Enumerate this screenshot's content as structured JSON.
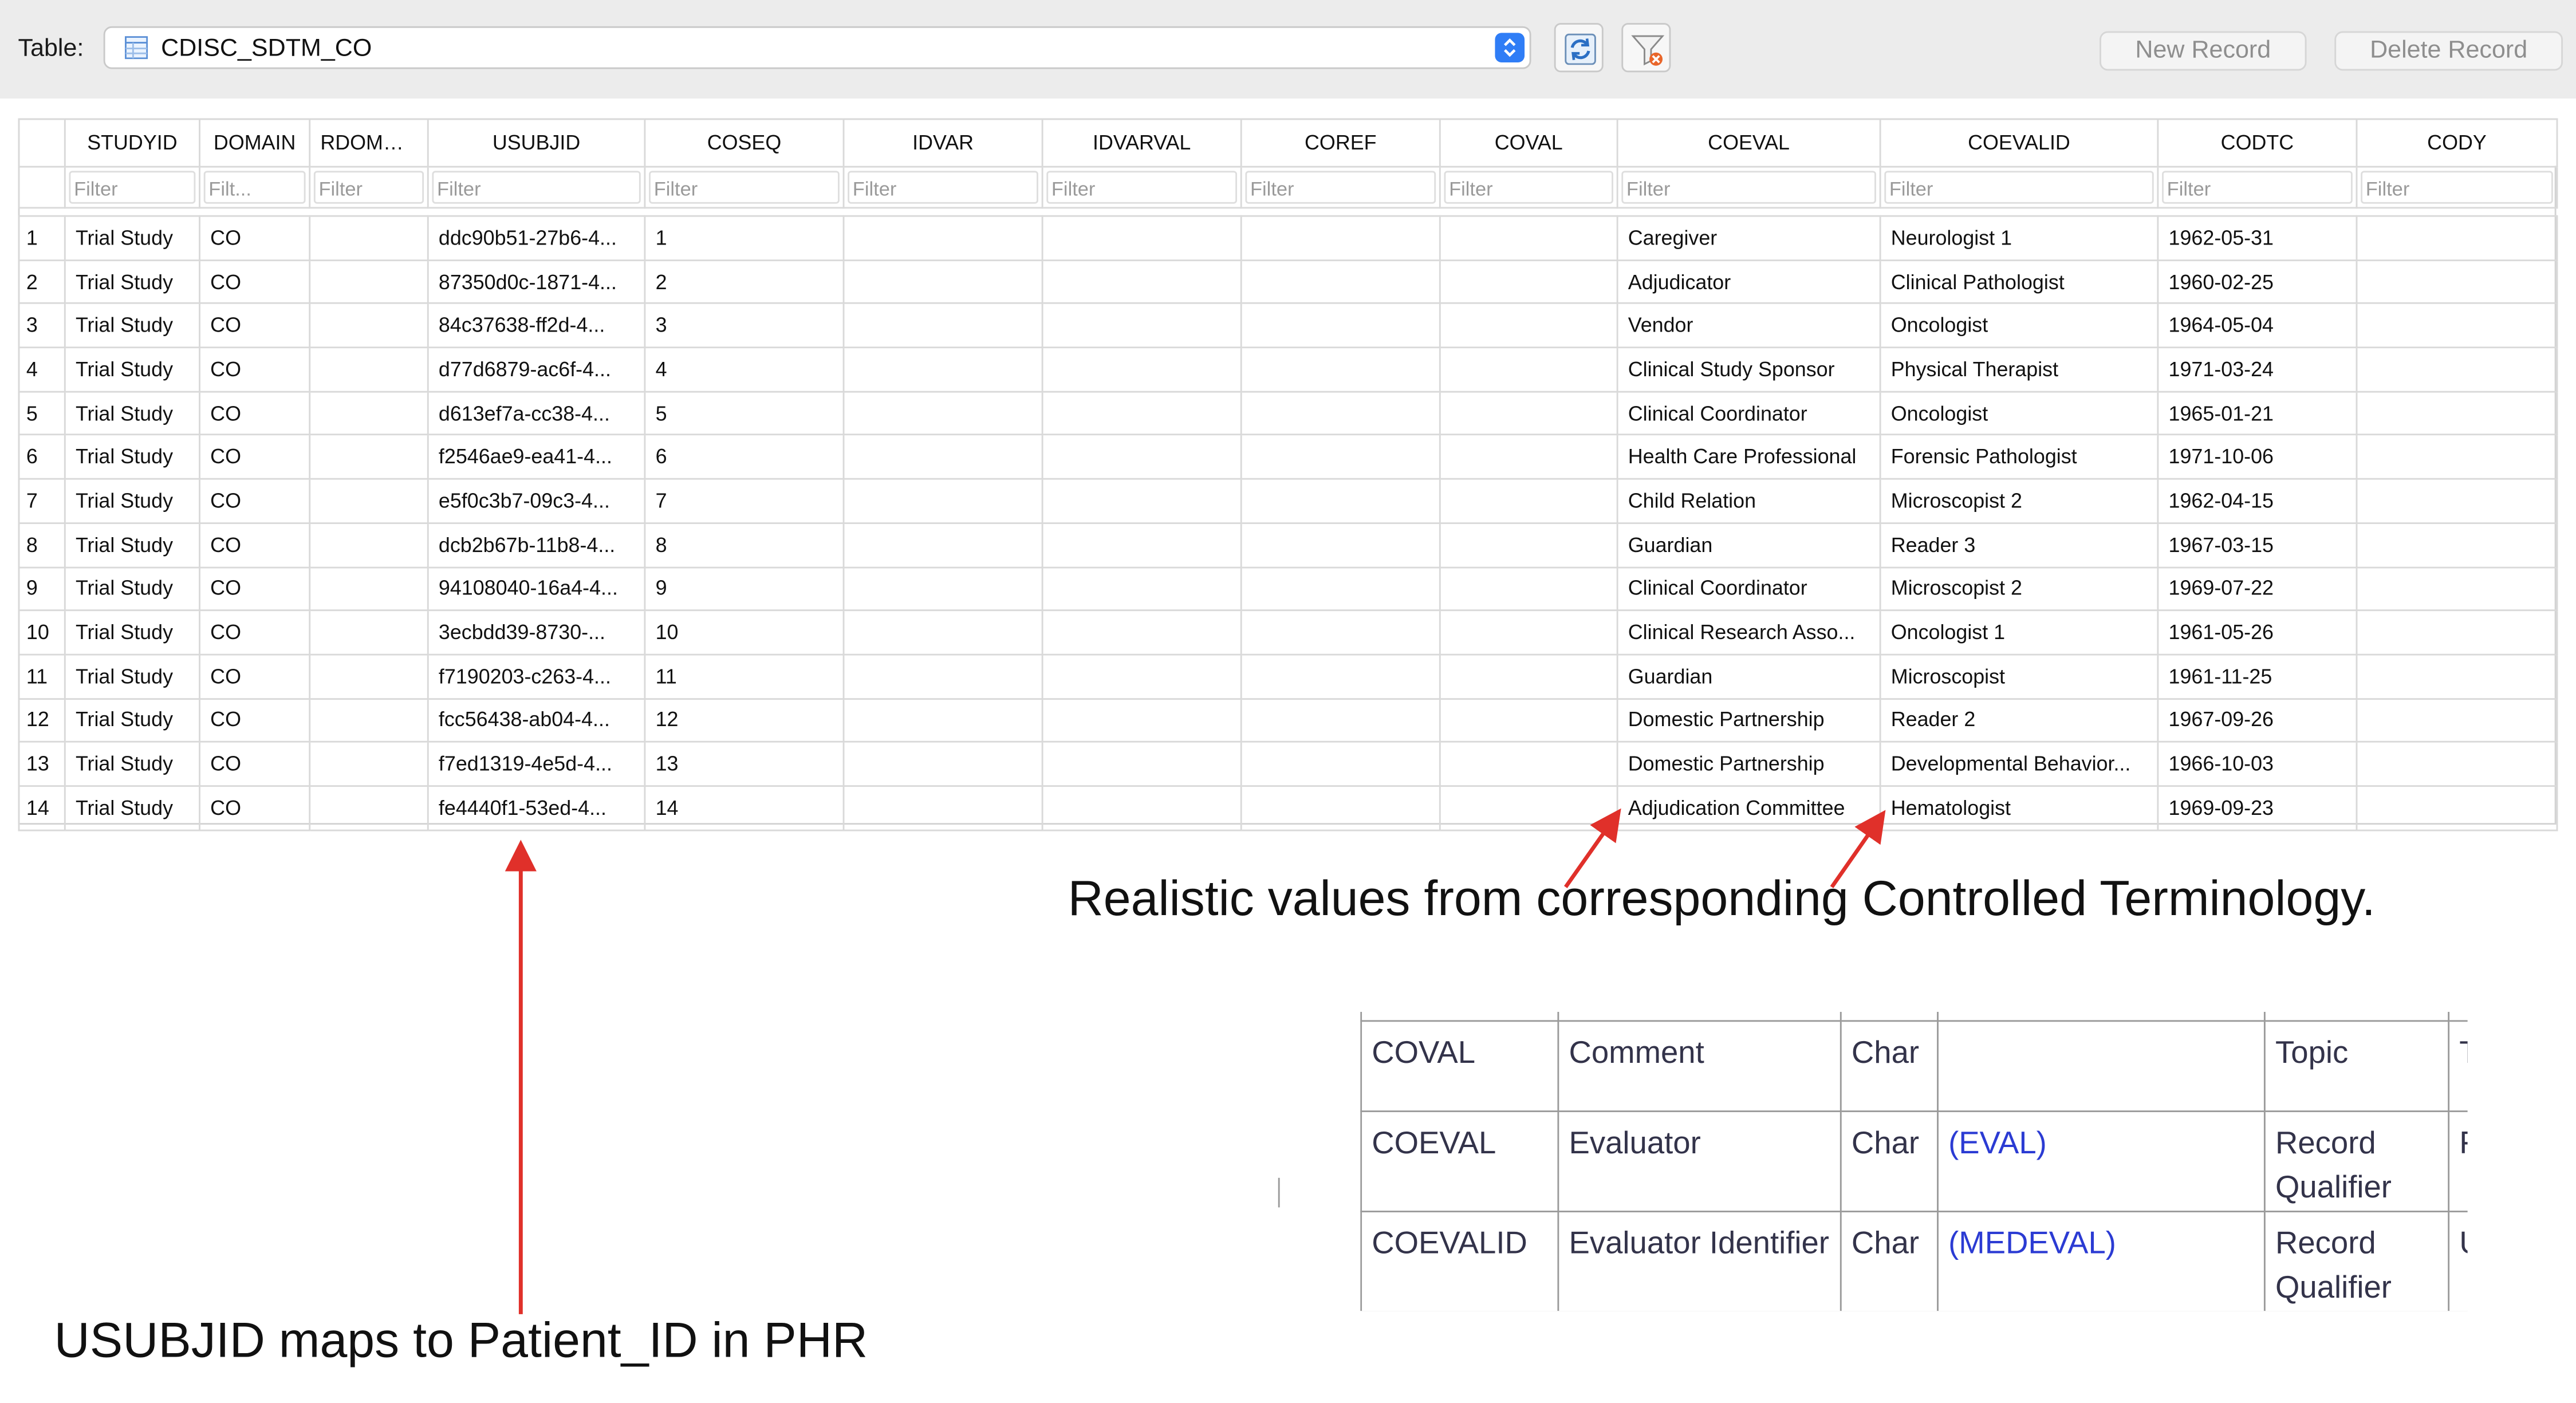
{
  "toolbar": {
    "table_label": "Table:",
    "table_name": "CDISC_SDTM_CO",
    "new_record": "New Record",
    "delete_record": "Delete Record",
    "icons": [
      "table-icon",
      "stepper-icon",
      "refresh-icon",
      "clear-filter-icon"
    ]
  },
  "grid": {
    "columns": [
      "STUDYID",
      "DOMAIN",
      "RDOMAIN",
      "USUBJID",
      "COSEQ",
      "IDVAR",
      "IDVARVAL",
      "COREF",
      "COVAL",
      "COEVAL",
      "COEVALID",
      "CODTC",
      "CODY"
    ],
    "filters": [
      "Filter",
      "Filt...",
      "Filter",
      "Filter",
      "Filter",
      "Filter",
      "Filter",
      "Filter",
      "Filter",
      "Filter",
      "Filter",
      "Filter",
      "Filter"
    ],
    "rows": [
      {
        "n": "1",
        "studyid": "Trial Study",
        "domain": "CO",
        "rdomain": "",
        "usubjid": "ddc90b51-27b6-4...",
        "coseq": "1",
        "idvar": "",
        "idvarval": "",
        "coref": "",
        "coval": "",
        "coeval": "Caregiver",
        "coevalid": "Neurologist 1",
        "codtc": "1962-05-31",
        "cody": ""
      },
      {
        "n": "2",
        "studyid": "Trial Study",
        "domain": "CO",
        "rdomain": "",
        "usubjid": "87350d0c-1871-4...",
        "coseq": "2",
        "idvar": "",
        "idvarval": "",
        "coref": "",
        "coval": "",
        "coeval": "Adjudicator",
        "coevalid": "Clinical Pathologist",
        "codtc": "1960-02-25",
        "cody": ""
      },
      {
        "n": "3",
        "studyid": "Trial Study",
        "domain": "CO",
        "rdomain": "",
        "usubjid": "84c37638-ff2d-4...",
        "coseq": "3",
        "idvar": "",
        "idvarval": "",
        "coref": "",
        "coval": "",
        "coeval": "Vendor",
        "coevalid": "Oncologist",
        "codtc": "1964-05-04",
        "cody": ""
      },
      {
        "n": "4",
        "studyid": "Trial Study",
        "domain": "CO",
        "rdomain": "",
        "usubjid": "d77d6879-ac6f-4...",
        "coseq": "4",
        "idvar": "",
        "idvarval": "",
        "coref": "",
        "coval": "",
        "coeval": "Clinical Study Sponsor",
        "coevalid": "Physical Therapist",
        "codtc": "1971-03-24",
        "cody": ""
      },
      {
        "n": "5",
        "studyid": "Trial Study",
        "domain": "CO",
        "rdomain": "",
        "usubjid": "d613ef7a-cc38-4...",
        "coseq": "5",
        "idvar": "",
        "idvarval": "",
        "coref": "",
        "coval": "",
        "coeval": "Clinical Coordinator",
        "coevalid": "Oncologist",
        "codtc": "1965-01-21",
        "cody": ""
      },
      {
        "n": "6",
        "studyid": "Trial Study",
        "domain": "CO",
        "rdomain": "",
        "usubjid": "f2546ae9-ea41-4...",
        "coseq": "6",
        "idvar": "",
        "idvarval": "",
        "coref": "",
        "coval": "",
        "coeval": "Health Care Professional",
        "coevalid": "Forensic Pathologist",
        "codtc": "1971-10-06",
        "cody": ""
      },
      {
        "n": "7",
        "studyid": "Trial Study",
        "domain": "CO",
        "rdomain": "",
        "usubjid": "e5f0c3b7-09c3-4...",
        "coseq": "7",
        "idvar": "",
        "idvarval": "",
        "coref": "",
        "coval": "",
        "coeval": "Child Relation",
        "coevalid": "Microscopist 2",
        "codtc": "1962-04-15",
        "cody": ""
      },
      {
        "n": "8",
        "studyid": "Trial Study",
        "domain": "CO",
        "rdomain": "",
        "usubjid": "dcb2b67b-11b8-4...",
        "coseq": "8",
        "idvar": "",
        "idvarval": "",
        "coref": "",
        "coval": "",
        "coeval": "Guardian",
        "coevalid": "Reader 3",
        "codtc": "1967-03-15",
        "cody": ""
      },
      {
        "n": "9",
        "studyid": "Trial Study",
        "domain": "CO",
        "rdomain": "",
        "usubjid": "94108040-16a4-4...",
        "coseq": "9",
        "idvar": "",
        "idvarval": "",
        "coref": "",
        "coval": "",
        "coeval": "Clinical Coordinator",
        "coevalid": "Microscopist 2",
        "codtc": "1969-07-22",
        "cody": ""
      },
      {
        "n": "10",
        "studyid": "Trial Study",
        "domain": "CO",
        "rdomain": "",
        "usubjid": "3ecbdd39-8730-...",
        "coseq": "10",
        "idvar": "",
        "idvarval": "",
        "coref": "",
        "coval": "",
        "coeval": "Clinical Research Asso...",
        "coevalid": "Oncologist 1",
        "codtc": "1961-05-26",
        "cody": ""
      },
      {
        "n": "11",
        "studyid": "Trial Study",
        "domain": "CO",
        "rdomain": "",
        "usubjid": "f7190203-c263-4...",
        "coseq": "11",
        "idvar": "",
        "idvarval": "",
        "coref": "",
        "coval": "",
        "coeval": "Guardian",
        "coevalid": "Microscopist",
        "codtc": "1961-11-25",
        "cody": ""
      },
      {
        "n": "12",
        "studyid": "Trial Study",
        "domain": "CO",
        "rdomain": "",
        "usubjid": "fcc56438-ab04-4...",
        "coseq": "12",
        "idvar": "",
        "idvarval": "",
        "coref": "",
        "coval": "",
        "coeval": "Domestic Partnership",
        "coevalid": "Reader 2",
        "codtc": "1967-09-26",
        "cody": ""
      },
      {
        "n": "13",
        "studyid": "Trial Study",
        "domain": "CO",
        "rdomain": "",
        "usubjid": "f7ed1319-4e5d-4...",
        "coseq": "13",
        "idvar": "",
        "idvarval": "",
        "coref": "",
        "coval": "",
        "coeval": "Domestic Partnership",
        "coevalid": "Developmental Behavior...",
        "codtc": "1966-10-03",
        "cody": ""
      },
      {
        "n": "14",
        "studyid": "Trial Study",
        "domain": "CO",
        "rdomain": "",
        "usubjid": "fe4440f1-53ed-4...",
        "coseq": "14",
        "idvar": "",
        "idvarval": "",
        "coref": "",
        "coval": "",
        "coeval": "Adjudication Committee",
        "coevalid": "Hematologist",
        "codtc": "1969-09-23",
        "cody": ""
      }
    ]
  },
  "annotations": {
    "ct_note": "Realistic values from corresponding Controlled Terminology.",
    "usubjid_note": "USUBJID maps to Patient_ID in PHR",
    "arrow_color": "#e0302a"
  },
  "ct_spec": {
    "rows": [
      {
        "name": "COVAL",
        "label": "Comment",
        "type": "Char",
        "ct": "",
        "role": "Topic",
        "extra": "T"
      },
      {
        "name": "COEVAL",
        "label": "Evaluator",
        "type": "Char",
        "ct": "(EVAL)",
        "role": "Record Qualifier",
        "extra": "F"
      },
      {
        "name": "COEVALID",
        "label": "Evaluator Identifier",
        "type": "Char",
        "ct": "(MEDEVAL)",
        "role": "Record Qualifier",
        "extra": "U"
      }
    ]
  }
}
